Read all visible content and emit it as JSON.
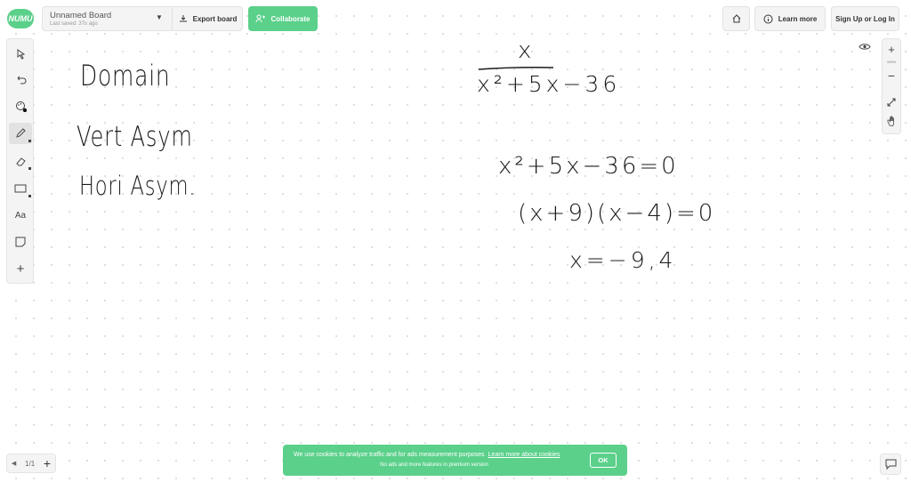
{
  "app": {
    "logo_text": "NUMU",
    "board_name": "Unnamed Board",
    "last_saved": "Last saved: 37s ago",
    "export_label": "Export board",
    "collaborate_label": "Collaborate",
    "learn_more_label": "Learn more",
    "signup_label": "Sign Up or Log In",
    "accent_color": "#5bd08a"
  },
  "toolbar": {
    "tools": [
      {
        "name": "select",
        "icon": "cursor-icon"
      },
      {
        "name": "undo",
        "icon": "undo-icon"
      },
      {
        "name": "color",
        "icon": "palette-icon"
      },
      {
        "name": "pen",
        "icon": "pen-icon",
        "active": true
      },
      {
        "name": "eraser",
        "icon": "eraser-icon"
      },
      {
        "name": "shape",
        "icon": "rectangle-icon"
      },
      {
        "name": "text",
        "icon": "text-icon",
        "label": "Aa"
      },
      {
        "name": "sticky",
        "icon": "sticky-note-icon"
      },
      {
        "name": "add",
        "icon": "plus-icon"
      }
    ]
  },
  "zoom": {
    "level": "100%"
  },
  "handwriting": {
    "domain": "Domain",
    "vert": "Vert Asym",
    "hori": "Hori Asym.",
    "numerator": "x",
    "denominator": "x²+5x−36",
    "eq1": "x²+5x−36=0",
    "eq2": "(x+9)(x−4)=0",
    "eq3": "x=−9,4"
  },
  "pager": {
    "page": "1/1"
  },
  "cookie": {
    "text": "We use cookies to analyze traffic and for ads measurement purposes",
    "link": "Learn more about cookies",
    "sub": "No ads and more features in premium version",
    "ok_label": "OK"
  }
}
